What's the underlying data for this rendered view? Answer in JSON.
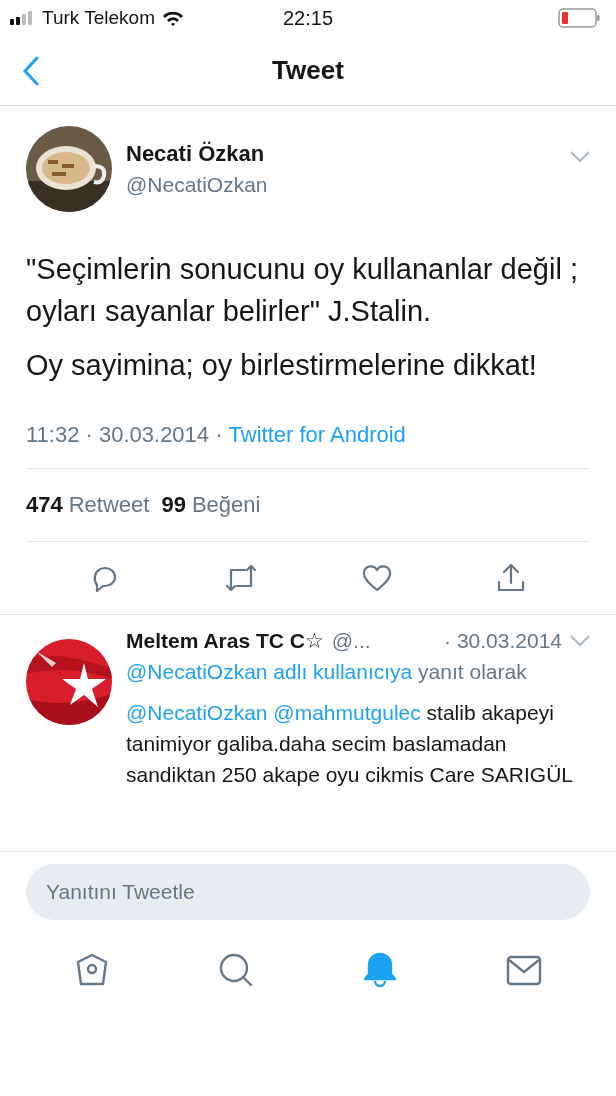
{
  "status_bar": {
    "carrier": "Turk Telekom",
    "time": "22:15"
  },
  "nav": {
    "title": "Tweet"
  },
  "tweet": {
    "author": "Necati Özkan",
    "handle": "@NecatiOzkan",
    "paragraphs": [
      "\"Seçimlerin sonucunu oy kullananlar değil ; oyları sayanlar belirler\" J.Stalin.",
      "Oy sayimina; oy birlestirmelerine dikkat!"
    ],
    "time": "11:32 · 30.03.2014 ·",
    "source": "Twitter for Android",
    "stats": [
      {
        "count": "474",
        "label": "Retweet"
      },
      {
        "count": "99",
        "label": "Beğeni"
      }
    ],
    "actions": [
      {
        "kind": "reply"
      },
      {
        "kind": "retweet"
      },
      {
        "kind": "like"
      },
      {
        "kind": "share"
      }
    ]
  },
  "reply": {
    "author": "Meltem Aras TC C☆",
    "handle": "@...",
    "date": "· 30.03.2014",
    "reply_to_link": "@NecatiOzkan adlı kullanıcıya",
    "reply_to_rest": "yanıt olarak",
    "mentions": "@NecatiOzkan @mahmutgulec",
    "text": "stalib akapeyi tanimiyor galiba.daha secim baslamadan sandiktan 250 akape oyu cikmis Care SARIGÜL"
  },
  "compose": {
    "placeholder": "Yanıtını Tweetle"
  },
  "tabs": [
    {
      "kind": "home",
      "selected": false
    },
    {
      "kind": "search",
      "selected": false
    },
    {
      "kind": "notifications",
      "selected": true
    },
    {
      "kind": "messages",
      "selected": false
    }
  ]
}
